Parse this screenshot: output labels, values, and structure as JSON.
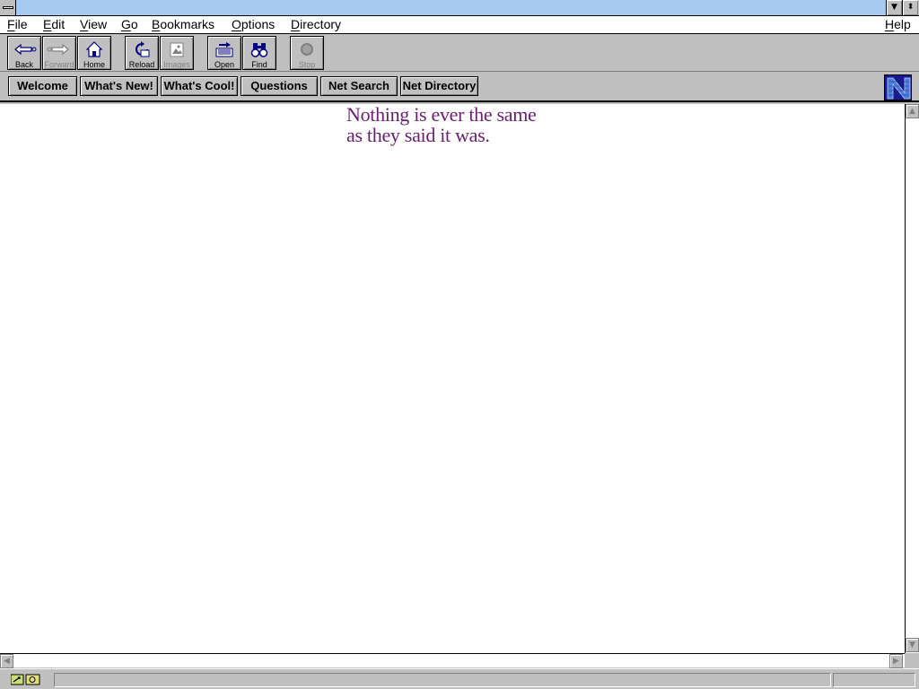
{
  "menubar": {
    "items": [
      "File",
      "Edit",
      "View",
      "Go",
      "Bookmarks",
      "Options",
      "Directory"
    ],
    "help": "Help"
  },
  "toolbar": {
    "back": "Back",
    "forward": "Forward",
    "home": "Home",
    "reload": "Reload",
    "images": "Images",
    "open": "Open",
    "find": "Find",
    "stop": "Stop"
  },
  "directory": {
    "welcome": "Welcome",
    "whats_new": "What's New!",
    "whats_cool": "What's Cool!",
    "questions": "Questions",
    "net_search": "Net Search",
    "net_directory": "Net Directory"
  },
  "content": {
    "line1": "Nothing is ever the same",
    "line2": "as they said it was.",
    "text_color": "#6b1e73"
  },
  "colors": {
    "titlebar": "#a6caf0",
    "chrome": "#c0c0c0",
    "logo": "#1a1a8c"
  }
}
